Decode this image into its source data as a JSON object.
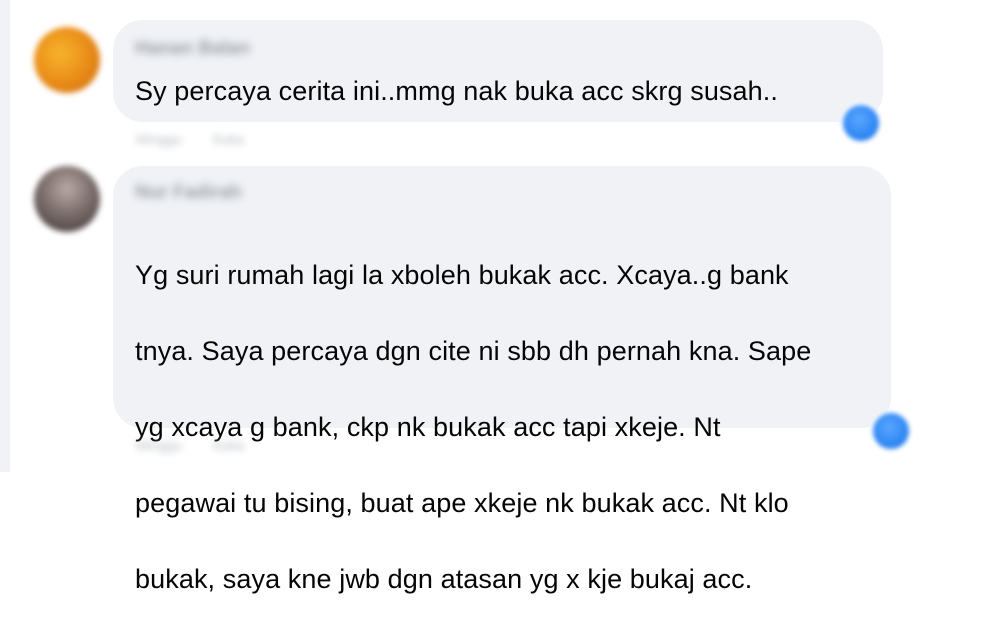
{
  "comments": [
    {
      "author": "Hanan Balan",
      "text": "Sy percaya cerita ini..mmg nak buka acc skrg susah..",
      "time": "Minggu",
      "action": "Suka"
    },
    {
      "author": "Nur Fadirah",
      "text_lines": [
        "Yg suri rumah lagi la xboleh bukak acc. Xcaya..g bank",
        "tnya. Saya percaya dgn cite ni sbb dh pernah kna. Sape",
        "yg xcaya g bank, ckp nk bukak acc tapi xkeje. Nt",
        "pegawai tu bising, buat ape xkeje nk bukak acc. Nt klo",
        "bukak, saya kne jwb dgn atasan yg x kje bukaj acc."
      ],
      "time": "Minggu",
      "action": "Suka"
    }
  ],
  "colors": {
    "bubble": "#f0f2f5",
    "text": "#050505",
    "reaction": "#2f87f4"
  },
  "icons": [
    "avatar-orange",
    "avatar-profile",
    "like-reaction-icon"
  ]
}
